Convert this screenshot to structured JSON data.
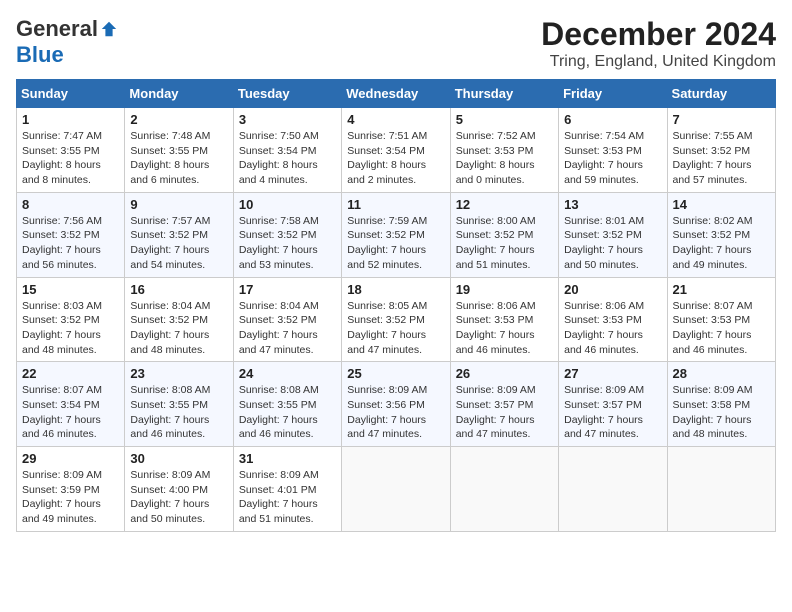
{
  "logo": {
    "general": "General",
    "blue": "Blue"
  },
  "title": "December 2024",
  "location": "Tring, England, United Kingdom",
  "weekdays": [
    "Sunday",
    "Monday",
    "Tuesday",
    "Wednesday",
    "Thursday",
    "Friday",
    "Saturday"
  ],
  "weeks": [
    [
      {
        "day": "1",
        "sunrise": "7:47 AM",
        "sunset": "3:55 PM",
        "daylight": "8 hours and 8 minutes."
      },
      {
        "day": "2",
        "sunrise": "7:48 AM",
        "sunset": "3:55 PM",
        "daylight": "8 hours and 6 minutes."
      },
      {
        "day": "3",
        "sunrise": "7:50 AM",
        "sunset": "3:54 PM",
        "daylight": "8 hours and 4 minutes."
      },
      {
        "day": "4",
        "sunrise": "7:51 AM",
        "sunset": "3:54 PM",
        "daylight": "8 hours and 2 minutes."
      },
      {
        "day": "5",
        "sunrise": "7:52 AM",
        "sunset": "3:53 PM",
        "daylight": "8 hours and 0 minutes."
      },
      {
        "day": "6",
        "sunrise": "7:54 AM",
        "sunset": "3:53 PM",
        "daylight": "7 hours and 59 minutes."
      },
      {
        "day": "7",
        "sunrise": "7:55 AM",
        "sunset": "3:52 PM",
        "daylight": "7 hours and 57 minutes."
      }
    ],
    [
      {
        "day": "8",
        "sunrise": "7:56 AM",
        "sunset": "3:52 PM",
        "daylight": "7 hours and 56 minutes."
      },
      {
        "day": "9",
        "sunrise": "7:57 AM",
        "sunset": "3:52 PM",
        "daylight": "7 hours and 54 minutes."
      },
      {
        "day": "10",
        "sunrise": "7:58 AM",
        "sunset": "3:52 PM",
        "daylight": "7 hours and 53 minutes."
      },
      {
        "day": "11",
        "sunrise": "7:59 AM",
        "sunset": "3:52 PM",
        "daylight": "7 hours and 52 minutes."
      },
      {
        "day": "12",
        "sunrise": "8:00 AM",
        "sunset": "3:52 PM",
        "daylight": "7 hours and 51 minutes."
      },
      {
        "day": "13",
        "sunrise": "8:01 AM",
        "sunset": "3:52 PM",
        "daylight": "7 hours and 50 minutes."
      },
      {
        "day": "14",
        "sunrise": "8:02 AM",
        "sunset": "3:52 PM",
        "daylight": "7 hours and 49 minutes."
      }
    ],
    [
      {
        "day": "15",
        "sunrise": "8:03 AM",
        "sunset": "3:52 PM",
        "daylight": "7 hours and 48 minutes."
      },
      {
        "day": "16",
        "sunrise": "8:04 AM",
        "sunset": "3:52 PM",
        "daylight": "7 hours and 48 minutes."
      },
      {
        "day": "17",
        "sunrise": "8:04 AM",
        "sunset": "3:52 PM",
        "daylight": "7 hours and 47 minutes."
      },
      {
        "day": "18",
        "sunrise": "8:05 AM",
        "sunset": "3:52 PM",
        "daylight": "7 hours and 47 minutes."
      },
      {
        "day": "19",
        "sunrise": "8:06 AM",
        "sunset": "3:53 PM",
        "daylight": "7 hours and 46 minutes."
      },
      {
        "day": "20",
        "sunrise": "8:06 AM",
        "sunset": "3:53 PM",
        "daylight": "7 hours and 46 minutes."
      },
      {
        "day": "21",
        "sunrise": "8:07 AM",
        "sunset": "3:53 PM",
        "daylight": "7 hours and 46 minutes."
      }
    ],
    [
      {
        "day": "22",
        "sunrise": "8:07 AM",
        "sunset": "3:54 PM",
        "daylight": "7 hours and 46 minutes."
      },
      {
        "day": "23",
        "sunrise": "8:08 AM",
        "sunset": "3:55 PM",
        "daylight": "7 hours and 46 minutes."
      },
      {
        "day": "24",
        "sunrise": "8:08 AM",
        "sunset": "3:55 PM",
        "daylight": "7 hours and 46 minutes."
      },
      {
        "day": "25",
        "sunrise": "8:09 AM",
        "sunset": "3:56 PM",
        "daylight": "7 hours and 47 minutes."
      },
      {
        "day": "26",
        "sunrise": "8:09 AM",
        "sunset": "3:57 PM",
        "daylight": "7 hours and 47 minutes."
      },
      {
        "day": "27",
        "sunrise": "8:09 AM",
        "sunset": "3:57 PM",
        "daylight": "7 hours and 47 minutes."
      },
      {
        "day": "28",
        "sunrise": "8:09 AM",
        "sunset": "3:58 PM",
        "daylight": "7 hours and 48 minutes."
      }
    ],
    [
      {
        "day": "29",
        "sunrise": "8:09 AM",
        "sunset": "3:59 PM",
        "daylight": "7 hours and 49 minutes."
      },
      {
        "day": "30",
        "sunrise": "8:09 AM",
        "sunset": "4:00 PM",
        "daylight": "7 hours and 50 minutes."
      },
      {
        "day": "31",
        "sunrise": "8:09 AM",
        "sunset": "4:01 PM",
        "daylight": "7 hours and 51 minutes."
      },
      null,
      null,
      null,
      null
    ]
  ]
}
